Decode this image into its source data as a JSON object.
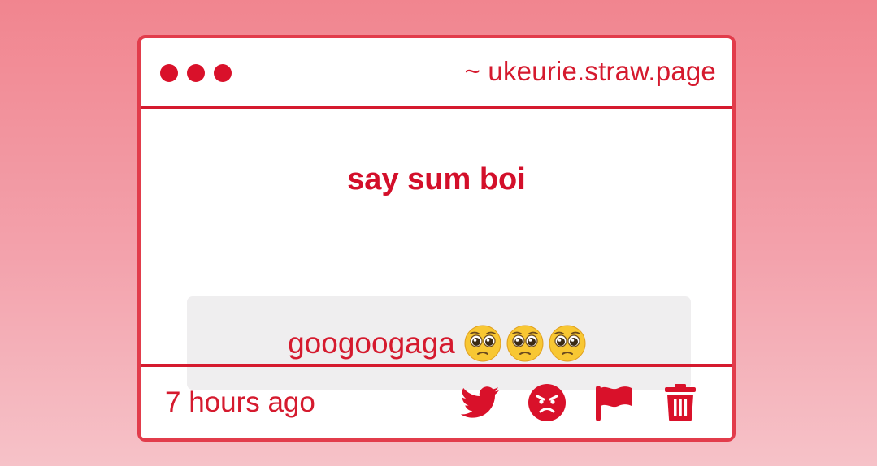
{
  "window": {
    "url": "~ ukeurie.straw.page",
    "dots": [
      "dot",
      "dot",
      "dot"
    ]
  },
  "post": {
    "question": "say sum boi",
    "answer_text": "googoogaga",
    "answer_emoji": [
      "pleading-face",
      "pleading-face",
      "pleading-face"
    ]
  },
  "footer": {
    "timestamp": "7 hours ago",
    "actions": [
      "twitter-icon",
      "angry-face-icon",
      "flag-icon",
      "trash-icon"
    ]
  },
  "colors": {
    "accent": "#d51a2e",
    "card_border": "#e23c4b",
    "answer_bg": "#efeeef",
    "background_top": "#f1858f",
    "background_bottom": "#f6c2c8"
  }
}
